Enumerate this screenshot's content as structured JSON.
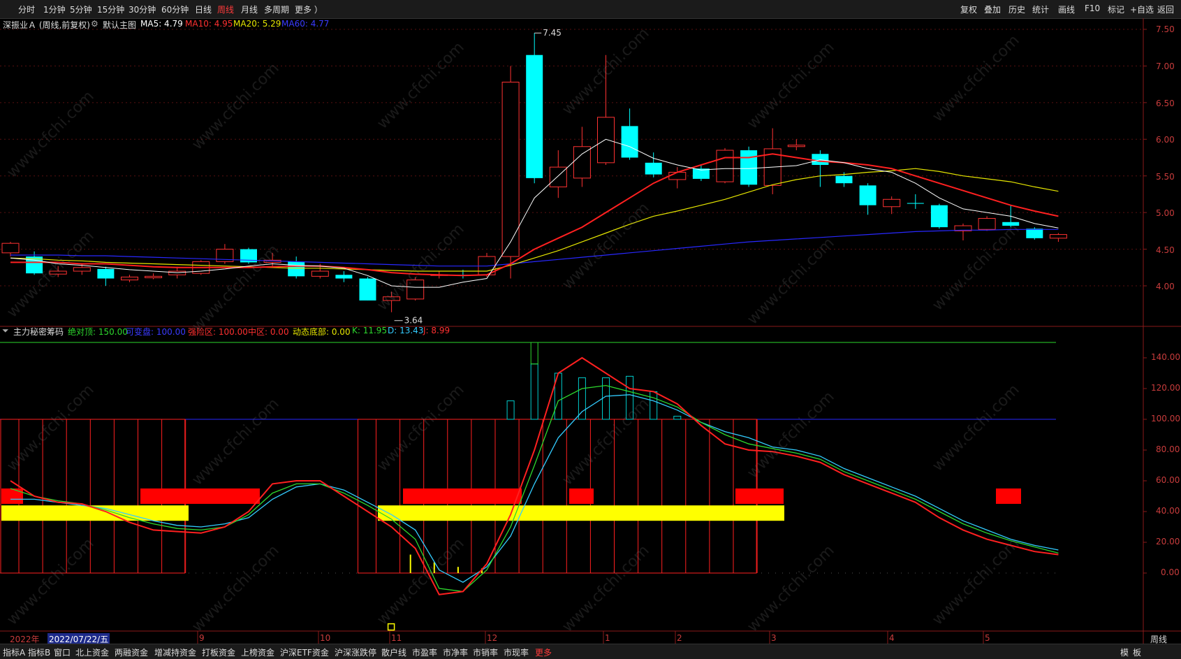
{
  "toolbar": {
    "periods": [
      "分时",
      "1分钟",
      "5分钟",
      "15分钟",
      "30分钟",
      "60分钟",
      "日线",
      "周线",
      "月线",
      "多周期",
      "更多 ）"
    ],
    "active_period": "周线",
    "right_tools": [
      "复权",
      "叠加",
      "历史",
      "统计",
      "画线",
      "F10",
      "标记",
      "+自选",
      "返回"
    ]
  },
  "main_info": {
    "title": "深振业Ａ (周线,前复权)",
    "template": "默认主图",
    "ma5": "MA5: 4.79",
    "ma10": "MA10: 4.95",
    "ma20": "MA20: 5.29",
    "ma60": "MA60: 4.77",
    "high_label": "7.45",
    "low_label": "3.64"
  },
  "indicator_info": {
    "name": "主力秘密筹码",
    "abs_top": "绝对顶: 150.00",
    "var_line": "可变盘: 100.00",
    "risk_zone": "强险区: 100.00",
    "mid_zone": "中区: 0.00",
    "dyn_bottom": "动态底部: 0.00",
    "k": "K: 11.95",
    "d": "D: 13.43",
    "j": "J: 8.99"
  },
  "price_axis": [
    "7.50",
    "7.00",
    "6.50",
    "6.00",
    "5.50",
    "5.00",
    "4.50",
    "4.00"
  ],
  "ind_axis": [
    "140.00",
    "120.00",
    "100.00",
    "80.00",
    "60.00",
    "40.00",
    "20.00",
    "0.00"
  ],
  "time_axis": {
    "year": "2022年",
    "cursor_date": "2022/07/22/五",
    "months": [
      "9",
      "10",
      "11",
      "12",
      "1",
      "2",
      "3",
      "4",
      "5"
    ]
  },
  "period_box": "周线",
  "bottom_tabs": [
    "指标A",
    "指标B",
    "窗口",
    "北上资金",
    "两融资金",
    "增减持资金",
    "打板资金",
    "上榜资金",
    "沪深ETF资金",
    "沪深涨跌停",
    "散户线",
    "市盈率",
    "市净率",
    "市销率",
    "市现率",
    "更多"
  ],
  "bottom_right": [
    "模",
    "板"
  ],
  "watermark_text": "www.cfchi.com",
  "colors": {
    "up": "#ff3232",
    "down": "#00ffff",
    "ma5": "#ffffff",
    "ma10": "#ff2020",
    "ma20": "#e6e600",
    "ma60": "#2828ff"
  },
  "chart_data": {
    "type": "candlestick",
    "candles": [
      {
        "o": 4.45,
        "c": 4.58,
        "h": 4.6,
        "l": 4.4
      },
      {
        "o": 4.4,
        "c": 4.17,
        "h": 4.47,
        "l": 4.15
      },
      {
        "o": 4.16,
        "c": 4.2,
        "h": 4.27,
        "l": 4.12
      },
      {
        "o": 4.2,
        "c": 4.25,
        "h": 4.3,
        "l": 4.15
      },
      {
        "o": 4.23,
        "c": 4.1,
        "h": 4.26,
        "l": 4.0
      },
      {
        "o": 4.08,
        "c": 4.12,
        "h": 4.15,
        "l": 4.05
      },
      {
        "o": 4.11,
        "c": 4.13,
        "h": 4.17,
        "l": 4.09
      },
      {
        "o": 4.15,
        "c": 4.2,
        "h": 4.26,
        "l": 4.1
      },
      {
        "o": 4.17,
        "c": 4.33,
        "h": 4.35,
        "l": 4.15
      },
      {
        "o": 4.33,
        "c": 4.5,
        "h": 4.57,
        "l": 4.3
      },
      {
        "o": 4.5,
        "c": 4.32,
        "h": 4.52,
        "l": 4.3
      },
      {
        "o": 4.32,
        "c": 4.35,
        "h": 4.45,
        "l": 4.25
      },
      {
        "o": 4.33,
        "c": 4.13,
        "h": 4.4,
        "l": 4.1
      },
      {
        "o": 4.13,
        "c": 4.2,
        "h": 4.3,
        "l": 4.1
      },
      {
        "o": 4.15,
        "c": 4.1,
        "h": 4.2,
        "l": 4.05
      },
      {
        "o": 4.1,
        "c": 3.8,
        "h": 4.12,
        "l": 3.8
      },
      {
        "o": 3.8,
        "c": 3.85,
        "h": 3.92,
        "l": 3.64
      },
      {
        "o": 3.82,
        "c": 4.08,
        "h": 4.12,
        "l": 3.8
      },
      {
        "o": 4.15,
        "c": 4.15,
        "h": 4.2,
        "l": 4.1
      },
      {
        "o": 4.15,
        "c": 4.14,
        "h": 4.22,
        "l": 4.1
      },
      {
        "o": 4.15,
        "c": 4.4,
        "h": 4.45,
        "l": 4.12
      },
      {
        "o": 4.4,
        "c": 6.78,
        "h": 7.0,
        "l": 4.1
      },
      {
        "o": 7.15,
        "c": 5.47,
        "h": 7.45,
        "l": 5.4
      },
      {
        "o": 5.35,
        "c": 5.62,
        "h": 5.85,
        "l": 5.2
      },
      {
        "o": 5.47,
        "c": 5.9,
        "h": 6.17,
        "l": 5.35
      },
      {
        "o": 5.68,
        "c": 6.3,
        "h": 7.15,
        "l": 5.65
      },
      {
        "o": 6.18,
        "c": 5.75,
        "h": 6.42,
        "l": 5.72
      },
      {
        "o": 5.68,
        "c": 5.52,
        "h": 5.82,
        "l": 5.48
      },
      {
        "o": 5.45,
        "c": 5.55,
        "h": 5.62,
        "l": 5.33
      },
      {
        "o": 5.6,
        "c": 5.46,
        "h": 5.65,
        "l": 5.43
      },
      {
        "o": 5.42,
        "c": 5.85,
        "h": 5.88,
        "l": 5.4
      },
      {
        "o": 5.85,
        "c": 5.38,
        "h": 5.9,
        "l": 5.35
      },
      {
        "o": 5.37,
        "c": 5.87,
        "h": 6.15,
        "l": 5.25
      },
      {
        "o": 5.9,
        "c": 5.92,
        "h": 6.0,
        "l": 5.85
      },
      {
        "o": 5.8,
        "c": 5.65,
        "h": 5.85,
        "l": 5.35
      },
      {
        "o": 5.5,
        "c": 5.4,
        "h": 5.55,
        "l": 5.35
      },
      {
        "o": 5.37,
        "c": 5.1,
        "h": 5.4,
        "l": 4.97
      },
      {
        "o": 5.08,
        "c": 5.18,
        "h": 5.22,
        "l": 4.98
      },
      {
        "o": 5.13,
        "c": 5.12,
        "h": 5.25,
        "l": 5.05
      },
      {
        "o": 5.1,
        "c": 4.8,
        "h": 5.12,
        "l": 4.78
      },
      {
        "o": 4.75,
        "c": 4.82,
        "h": 4.85,
        "l": 4.62
      },
      {
        "o": 4.77,
        "c": 4.92,
        "h": 4.95,
        "l": 4.75
      },
      {
        "o": 4.87,
        "c": 4.82,
        "h": 5.1,
        "l": 4.8
      },
      {
        "o": 4.78,
        "c": 4.65,
        "h": 4.8,
        "l": 4.63
      },
      {
        "o": 4.65,
        "c": 4.7,
        "h": 4.72,
        "l": 4.6
      }
    ],
    "ma5": [
      4.38,
      4.35,
      4.3,
      4.28,
      4.25,
      4.22,
      4.2,
      4.18,
      4.2,
      4.23,
      4.27,
      4.3,
      4.28,
      4.27,
      4.24,
      4.14,
      4.0,
      3.98,
      3.98,
      4.05,
      4.1,
      4.6,
      5.2,
      5.5,
      5.8,
      6.0,
      5.9,
      5.74,
      5.65,
      5.58,
      5.6,
      5.6,
      5.62,
      5.64,
      5.72,
      5.68,
      5.6,
      5.55,
      5.4,
      5.2,
      5.05,
      5.0,
      4.95,
      4.85,
      4.79
    ],
    "ma10": [
      4.32,
      4.32,
      4.32,
      4.3,
      4.3,
      4.28,
      4.26,
      4.25,
      4.25,
      4.25,
      4.25,
      4.26,
      4.27,
      4.27,
      4.25,
      4.22,
      4.18,
      4.16,
      4.15,
      4.14,
      4.15,
      4.3,
      4.5,
      4.65,
      4.8,
      5.0,
      5.2,
      5.4,
      5.55,
      5.65,
      5.75,
      5.75,
      5.8,
      5.75,
      5.7,
      5.68,
      5.65,
      5.6,
      5.5,
      5.4,
      5.3,
      5.2,
      5.1,
      5.02,
      4.95
    ],
    "ma20": [
      4.38,
      4.37,
      4.35,
      4.34,
      4.32,
      4.31,
      4.3,
      4.29,
      4.28,
      4.27,
      4.26,
      4.25,
      4.24,
      4.24,
      4.23,
      4.22,
      4.21,
      4.2,
      4.2,
      4.2,
      4.2,
      4.28,
      4.38,
      4.48,
      4.6,
      4.72,
      4.84,
      4.95,
      5.02,
      5.1,
      5.18,
      5.28,
      5.38,
      5.45,
      5.5,
      5.52,
      5.55,
      5.57,
      5.6,
      5.56,
      5.5,
      5.46,
      5.42,
      5.35,
      5.29
    ],
    "ma60": [
      4.42,
      4.42,
      4.42,
      4.41,
      4.41,
      4.4,
      4.39,
      4.38,
      4.37,
      4.36,
      4.35,
      4.34,
      4.33,
      4.32,
      4.31,
      4.3,
      4.29,
      4.28,
      4.27,
      4.27,
      4.27,
      4.3,
      4.33,
      4.36,
      4.39,
      4.42,
      4.45,
      4.48,
      4.51,
      4.54,
      4.57,
      4.6,
      4.62,
      4.64,
      4.66,
      4.68,
      4.7,
      4.72,
      4.74,
      4.75,
      4.76,
      4.76,
      4.77,
      4.77,
      4.77
    ],
    "ind_k": [
      60,
      50,
      46,
      45,
      40,
      33,
      28,
      27,
      26,
      30,
      40,
      58,
      60,
      60,
      50,
      40,
      30,
      16,
      -14,
      -12,
      6,
      38,
      80,
      130,
      140,
      130,
      120,
      118,
      110,
      96,
      84,
      80,
      79,
      76,
      72,
      64,
      58,
      52,
      46,
      36,
      28,
      22,
      18,
      14,
      12
    ],
    "ind_d": [
      55,
      50,
      47,
      45,
      41,
      36,
      32,
      29,
      28,
      30,
      38,
      52,
      58,
      58,
      52,
      44,
      35,
      22,
      -10,
      -12,
      2,
      30,
      70,
      112,
      120,
      122,
      118,
      114,
      108,
      98,
      90,
      84,
      81,
      78,
      74,
      66,
      60,
      54,
      48,
      40,
      32,
      26,
      21,
      17,
      13
    ],
    "ind_j": [
      48,
      48,
      46,
      44,
      42,
      38,
      34,
      31,
      30,
      32,
      36,
      48,
      56,
      58,
      54,
      46,
      38,
      28,
      2,
      -6,
      4,
      24,
      58,
      88,
      105,
      115,
      116,
      112,
      106,
      98,
      92,
      88,
      82,
      80,
      76,
      68,
      62,
      56,
      50,
      42,
      34,
      28,
      22,
      18,
      15
    ],
    "ind_ylim": [
      -30,
      150
    ]
  }
}
